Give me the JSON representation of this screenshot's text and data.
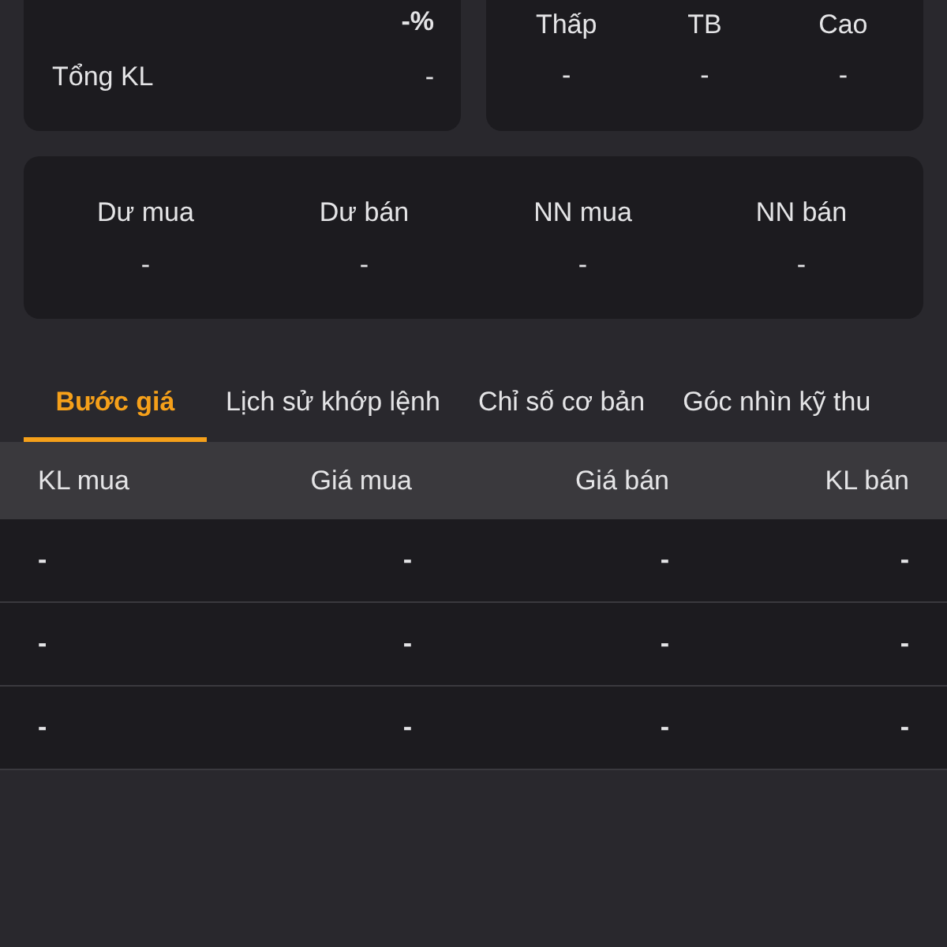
{
  "summary_left": {
    "change_percent": "-%",
    "rows": [
      {
        "label": "Tổng KL",
        "value": "-"
      }
    ]
  },
  "summary_right": {
    "columns": [
      {
        "label": "Thấp",
        "value": "-"
      },
      {
        "label": "TB",
        "value": "-"
      },
      {
        "label": "Cao",
        "value": "-"
      }
    ]
  },
  "stats": [
    {
      "label": "Dư mua",
      "value": "-"
    },
    {
      "label": "Dư bán",
      "value": "-"
    },
    {
      "label": "NN mua",
      "value": "-"
    },
    {
      "label": "NN bán",
      "value": "-"
    }
  ],
  "tabs": [
    {
      "label": "Bước giá",
      "selected": true
    },
    {
      "label": "Lịch sử khớp lệnh",
      "selected": false
    },
    {
      "label": "Chỉ số cơ bản",
      "selected": false
    },
    {
      "label": "Góc nhìn kỹ thu",
      "selected": false
    }
  ],
  "table": {
    "columns": [
      "KL mua",
      "Giá mua",
      "Giá bán",
      "KL bán"
    ],
    "rows": [
      [
        "-",
        "-",
        "-",
        "-"
      ],
      [
        "-",
        "-",
        "-",
        "-"
      ],
      [
        "-",
        "-",
        "-",
        "-"
      ]
    ]
  }
}
